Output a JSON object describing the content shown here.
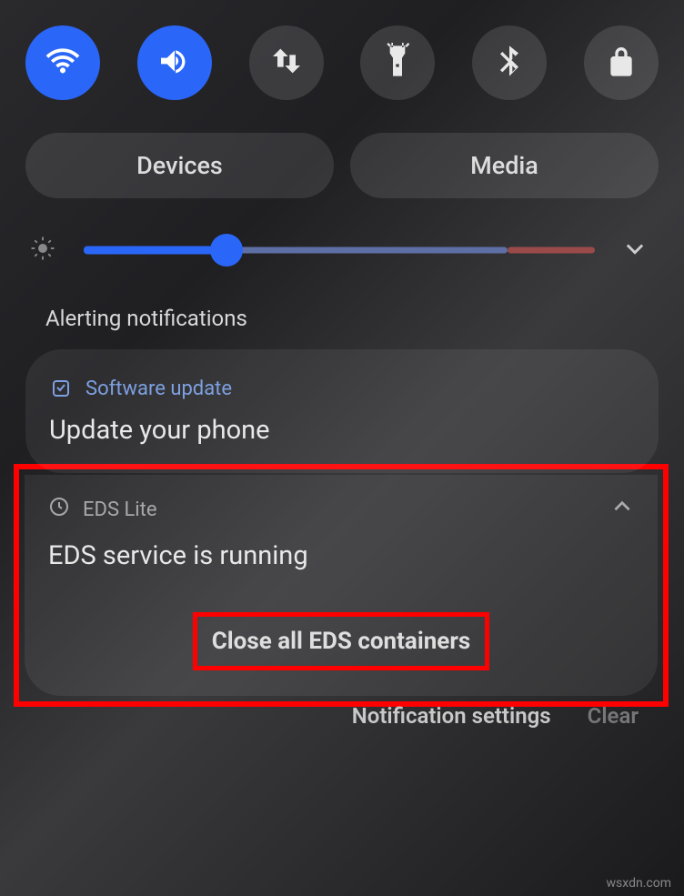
{
  "quick_toggles": {
    "wifi": {
      "name": "wifi",
      "active": true
    },
    "sound": {
      "name": "sound",
      "active": true
    },
    "data": {
      "name": "mobile-data",
      "active": false
    },
    "flashlight": {
      "name": "flashlight",
      "active": false
    },
    "bluetooth": {
      "name": "bluetooth",
      "active": false
    },
    "rotation": {
      "name": "rotation-lock",
      "active": false
    }
  },
  "chips": {
    "devices": "Devices",
    "media": "Media"
  },
  "brightness": {
    "value_percent": 28
  },
  "section_title": "Alerting notifications",
  "notif1": {
    "app": "Software update",
    "title": "Update your phone"
  },
  "notif2": {
    "app": "EDS Lite",
    "title": "EDS service is running",
    "action": "Close all EDS containers"
  },
  "footer": {
    "settings": "Notification settings",
    "clear": "Clear"
  },
  "watermark": "wsxdn.com"
}
